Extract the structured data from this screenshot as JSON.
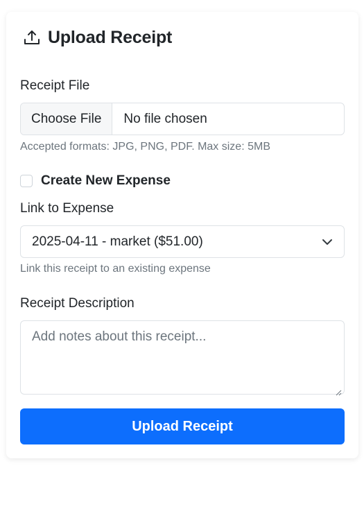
{
  "card": {
    "title": "Upload Receipt",
    "title_icon": "upload-icon"
  },
  "receipt_file": {
    "label": "Receipt File",
    "button_label": "Choose File",
    "status": "No file chosen",
    "help": "Accepted formats: JPG, PNG, PDF. Max size: 5MB"
  },
  "create_expense": {
    "label": "Create New Expense",
    "checked": false
  },
  "link_expense": {
    "label": "Link to Expense",
    "selected": "2025-04-11 - market ($51.00)",
    "help": "Link this receipt to an existing expense",
    "icon": "chevron-down-icon"
  },
  "description": {
    "label": "Receipt Description",
    "placeholder": "Add notes about this receipt..."
  },
  "submit": {
    "label": "Upload Receipt",
    "color": "#0d6efd"
  }
}
